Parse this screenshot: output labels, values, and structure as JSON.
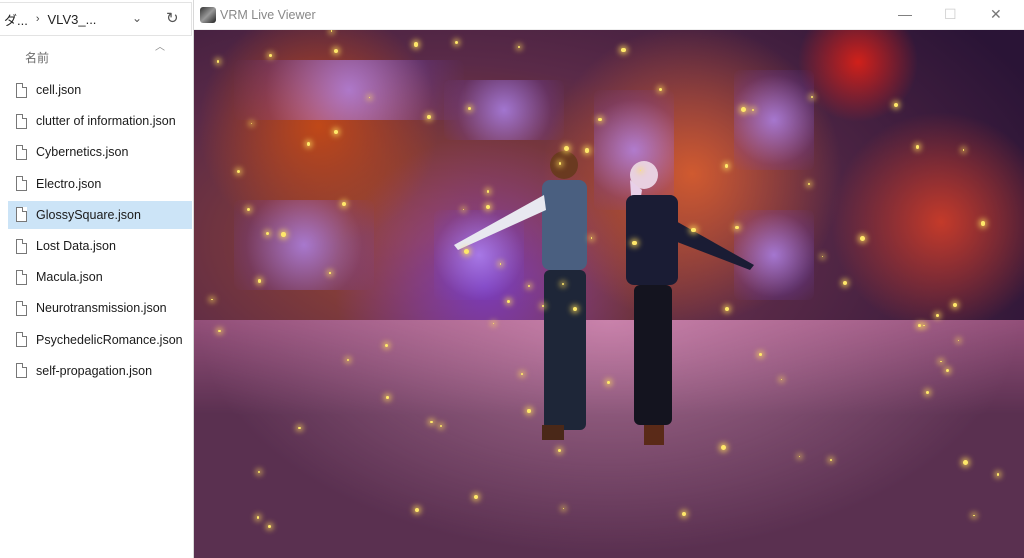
{
  "explorer": {
    "breadcrumb_parent": "ダ...",
    "breadcrumb_current": "VLV3_...",
    "column_header": "名前",
    "files": [
      "cell.json",
      "clutter of information.json",
      "Cybernetics.json",
      "Electro.json",
      "GlossySquare.json",
      "Lost Data.json",
      "Macula.json",
      "Neurotransmission.json",
      "PsychedelicRomance.json",
      "self-propagation.json"
    ],
    "selected_file": "GlossySquare.json"
  },
  "viewer": {
    "title": "VRM Live Viewer",
    "minimize": "—",
    "maximize": "☐",
    "close": "✕"
  }
}
